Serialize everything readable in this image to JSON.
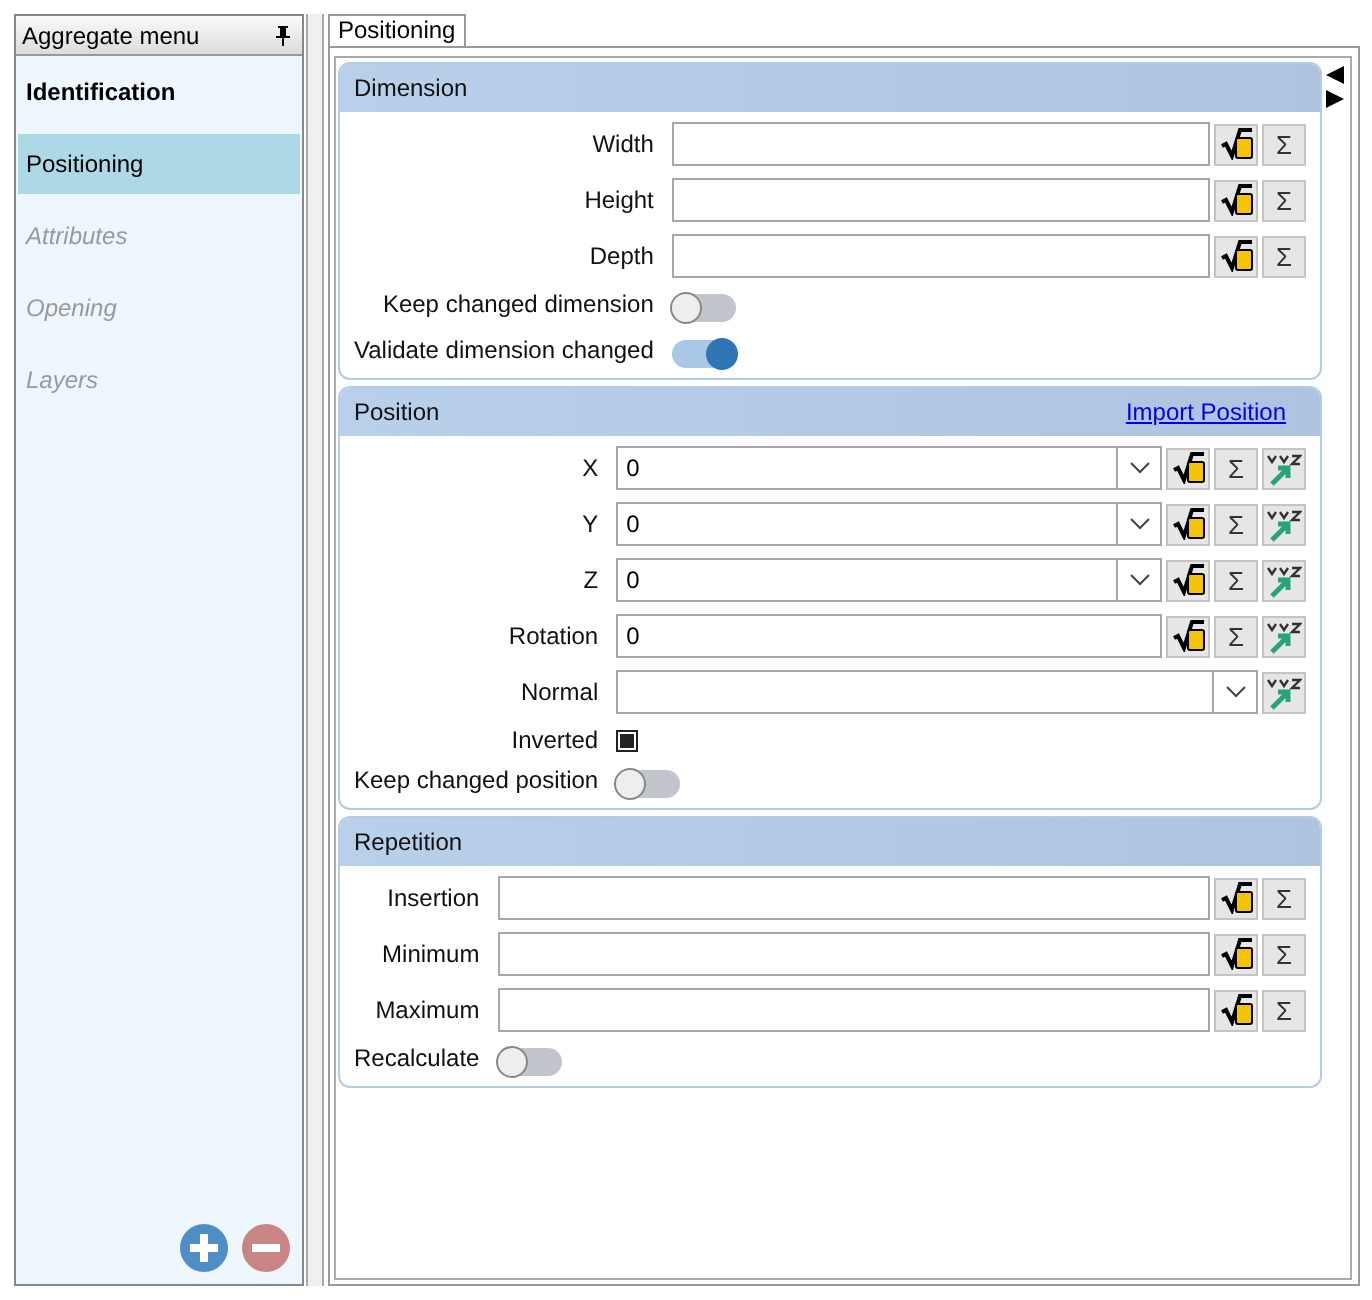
{
  "sidebar": {
    "title": "Aggregate menu",
    "items": [
      {
        "label": "Identification",
        "selected": false,
        "bold": true,
        "disabled": false
      },
      {
        "label": "Positioning",
        "selected": true,
        "bold": false,
        "disabled": false
      },
      {
        "label": "Attributes",
        "selected": false,
        "bold": false,
        "disabled": true
      },
      {
        "label": "Opening",
        "selected": false,
        "bold": false,
        "disabled": true
      },
      {
        "label": "Layers",
        "selected": false,
        "bold": false,
        "disabled": true
      }
    ]
  },
  "tabs": [
    {
      "label": "Positioning",
      "selected": true
    }
  ],
  "sections": [
    {
      "title": "Dimension",
      "rows": [
        {
          "kind": "field",
          "label": "Width",
          "dropdown": false,
          "buttons": [
            {
              "kind": "formula"
            },
            {
              "kind": "sum",
              "label": "Σ"
            }
          ]
        },
        {
          "kind": "field",
          "label": "Height",
          "dropdown": false,
          "buttons": [
            {
              "kind": "formula"
            },
            {
              "kind": "sum",
              "label": "Σ"
            }
          ]
        },
        {
          "kind": "field",
          "label": "Depth",
          "dropdown": false,
          "buttons": [
            {
              "kind": "formula"
            },
            {
              "kind": "sum",
              "label": "Σ"
            }
          ]
        },
        {
          "kind": "toggle",
          "label": "Keep changed dimension",
          "on": false
        },
        {
          "kind": "toggle",
          "label": "Validate dimension changed",
          "on": true
        }
      ]
    },
    {
      "title": "Position",
      "link": "Import Position",
      "rows": [
        {
          "kind": "field",
          "label": "X",
          "value": "0",
          "dropdown": true,
          "buttons": [
            {
              "kind": "formula"
            },
            {
              "kind": "sum",
              "label": "Σ"
            },
            {
              "kind": "pick"
            }
          ]
        },
        {
          "kind": "field",
          "label": "Y",
          "value": "0",
          "dropdown": true,
          "buttons": [
            {
              "kind": "formula"
            },
            {
              "kind": "sum",
              "label": "Σ"
            },
            {
              "kind": "pick"
            }
          ]
        },
        {
          "kind": "field",
          "label": "Z",
          "value": "0",
          "dropdown": true,
          "buttons": [
            {
              "kind": "formula"
            },
            {
              "kind": "sum",
              "label": "Σ"
            },
            {
              "kind": "pick"
            }
          ]
        },
        {
          "kind": "field",
          "label": "Rotation",
          "value": "0",
          "dropdown": false,
          "buttons": [
            {
              "kind": "formula"
            },
            {
              "kind": "sum",
              "label": "Σ"
            },
            {
              "kind": "pick"
            }
          ]
        },
        {
          "kind": "field",
          "label": "Normal",
          "dropdown": true,
          "buttons": [
            {
              "kind": "pick"
            }
          ]
        },
        {
          "kind": "checkbox",
          "label": "Inverted",
          "checked": true
        },
        {
          "kind": "toggle",
          "label": "Keep changed position",
          "on": false
        }
      ]
    },
    {
      "title": "Repetition",
      "rows": [
        {
          "kind": "field",
          "label": "Insertion",
          "dropdown": false,
          "buttons": [
            {
              "kind": "formula"
            },
            {
              "kind": "sum",
              "label": "Σ"
            }
          ]
        },
        {
          "kind": "field",
          "label": "Minimum",
          "dropdown": false,
          "buttons": [
            {
              "kind": "formula"
            },
            {
              "kind": "sum",
              "label": "Σ"
            }
          ]
        },
        {
          "kind": "field",
          "label": "Maximum",
          "dropdown": false,
          "buttons": [
            {
              "kind": "formula"
            },
            {
              "kind": "sum",
              "label": "Σ"
            }
          ]
        },
        {
          "kind": "toggle",
          "label": "Recalculate",
          "on": false
        }
      ]
    }
  ]
}
